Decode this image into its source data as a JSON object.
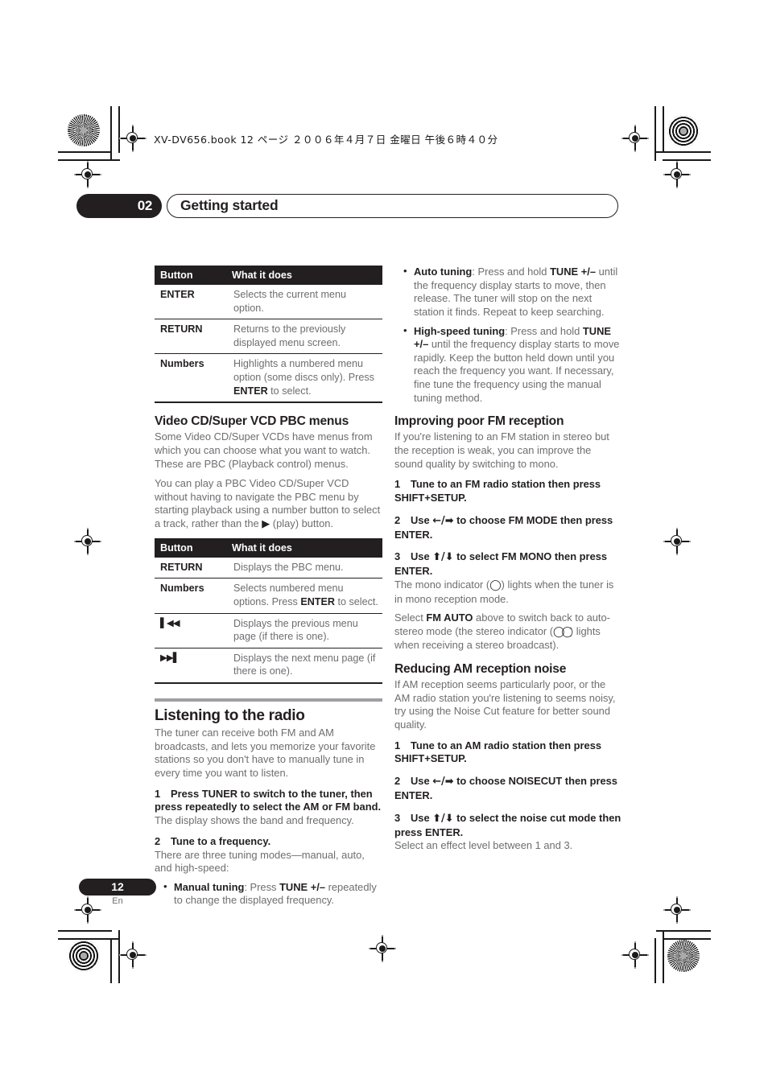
{
  "page": {
    "book_line": "XV-DV656.book  12 ページ  ２００６年４月７日  金曜日  午後６時４０分",
    "chapter_number": "02",
    "chapter_title": "Getting started",
    "page_number": "12",
    "language_code": "En"
  },
  "left_column": {
    "table_menu": {
      "headers": [
        "Button",
        "What it does"
      ],
      "rows": [
        {
          "button": "ENTER",
          "what": "Selects the current menu option."
        },
        {
          "button": "RETURN",
          "what": "Returns to the previously displayed menu screen."
        },
        {
          "button": "Numbers",
          "what_a": "Highlights a numbered menu option (some discs only). Press ",
          "what_b": "ENTER",
          "what_c": " to select."
        }
      ]
    },
    "pbc_heading": "Video CD/Super VCD PBC menus",
    "pbc_para_1": "Some Video CD/Super VCDs have menus from which you can choose what you want to watch. These are PBC (Playback control) menus.",
    "pbc_para_2a": "You can play a PBC Video CD/Super VCD without having to navigate the PBC menu by starting playback using a number button to select a track, rather than the ",
    "pbc_play_glyph": "▶",
    "pbc_para_2b": " (play) button.",
    "table_pbc": {
      "headers": [
        "Button",
        "What it does"
      ],
      "rows": [
        {
          "button": "RETURN",
          "what": "Displays the PBC menu."
        },
        {
          "button": "Numbers",
          "what_a": "Selects numbered menu options. Press ",
          "what_b": "ENTER",
          "what_c": " to select."
        },
        {
          "button": "◀◀",
          "button_prefix": "▌",
          "what": "Displays the previous menu page (if there is one)."
        },
        {
          "button": "▶▶",
          "button_suffix": "▌",
          "what": "Displays the next menu page (if there is one)."
        }
      ]
    },
    "radio_heading": "Listening to the radio",
    "radio_para": "The tuner can receive both FM and AM broadcasts, and lets you memorize your favorite stations so you don't have to manually tune in every time you want to listen.",
    "step1_num": "1",
    "step1_text": "Press TUNER to switch to the tuner, then press repeatedly to select the AM or FM band.",
    "step1_sub": "The display shows the band and frequency.",
    "step2_num": "2",
    "step2_text": "Tune to a frequency.",
    "step2_sub": "There are three tuning modes—manual, auto, and high-speed:",
    "manual_bullet_label": "Manual tuning",
    "manual_bullet_a": ": Press ",
    "manual_bullet_key": "TUNE +/–",
    "manual_bullet_b": " repeatedly to change the displayed frequency."
  },
  "right_column": {
    "auto_bullet_label": "Auto tuning",
    "auto_bullet_a": ": Press and hold ",
    "auto_bullet_key": "TUNE +/–",
    "auto_bullet_b": " until the frequency display starts to move, then release. The tuner will stop on the next station it finds. Repeat to keep searching.",
    "hs_bullet_label": "High-speed tuning",
    "hs_bullet_a": ": Press and hold ",
    "hs_bullet_key": "TUNE +/–",
    "hs_bullet_b": " until the frequency display starts to move rapidly. Keep the button held down until you reach the frequency you want. If necessary, fine tune the frequency using the manual tuning method.",
    "fm_heading": "Improving poor FM reception",
    "fm_para": "If you're listening to an FM station in stereo but the reception is weak, you can improve the sound quality by switching to mono.",
    "fm_step1_num": "1",
    "fm_step1_text": "Tune to an FM radio station then press SHIFT+SETUP.",
    "fm_step2_num": "2",
    "fm_step2_a": "Use ",
    "fm_step2_arrows": "←/➡",
    "fm_step2_b": " to choose FM MODE then press ENTER.",
    "fm_step3_num": "3",
    "fm_step3_a": "Use ",
    "fm_step3_arrows": "⬆/⬇",
    "fm_step3_b": " to select FM MONO then press ENTER.",
    "fm_step3_sub_a": "The mono indicator (",
    "fm_mono_glyph": "◯",
    "fm_step3_sub_b": ") lights when the tuner is in mono reception mode.",
    "fm_auto_a": "Select ",
    "fm_auto_key": "FM AUTO",
    "fm_auto_b": " above to switch back to auto-stereo mode (the stereo indicator (",
    "fm_stereo_glyph": "◯◯",
    "fm_auto_c": ") lights when receiving a stereo broadcast).",
    "am_heading": "Reducing AM reception noise",
    "am_para": "If AM reception seems particularly poor, or the AM radio station you're listening to seems noisy, try using the Noise Cut feature for better sound quality.",
    "am_step1_num": "1",
    "am_step1_text": "Tune to an AM radio station then press SHIFT+SETUP.",
    "am_step2_num": "2",
    "am_step2_a": "Use ",
    "am_step2_arrows": "←/➡",
    "am_step2_b": " to choose NOISECUT then press ENTER.",
    "am_step3_num": "3",
    "am_step3_a": "Use ",
    "am_step3_arrows": "⬆/⬇",
    "am_step3_b": " to select the noise cut mode then press ENTER.",
    "am_step3_sub": "Select an effect level between 1 and 3."
  },
  "colors": {
    "ink": "#231f20",
    "body_gray": "#6d6e71",
    "rule_gray": "#9d9fa2"
  }
}
